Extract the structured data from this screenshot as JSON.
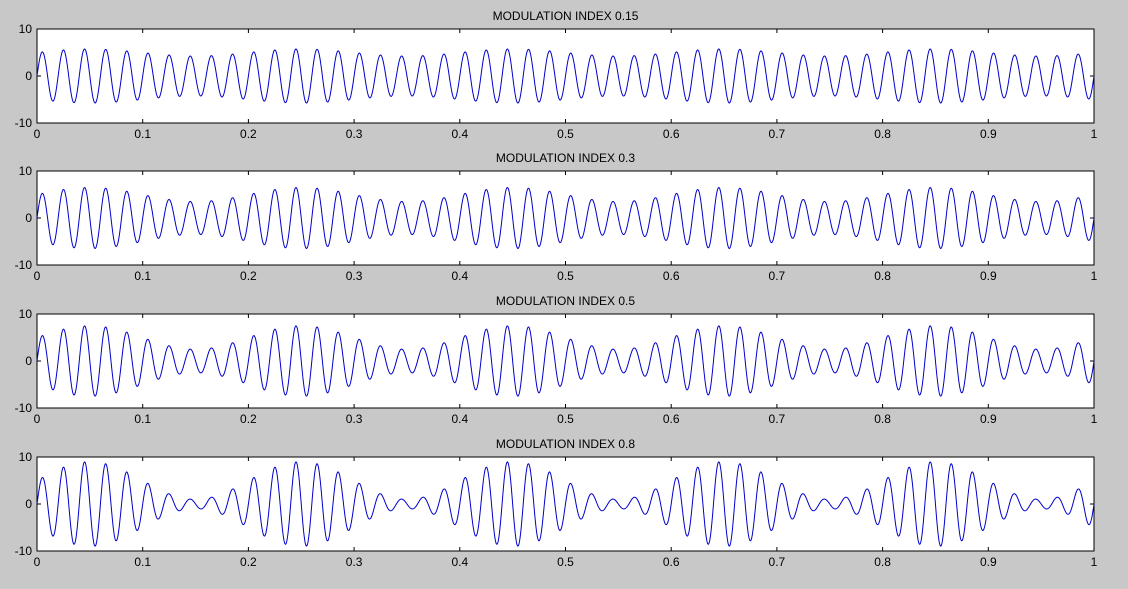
{
  "figure": {
    "background": "#c8c8c8",
    "axes_background": "#ffffff",
    "line_color": "#0000cc"
  },
  "chart_data": [
    {
      "type": "line",
      "title": "MODULATION INDEX 0.15",
      "xlabel": "",
      "ylabel": "",
      "xlim": [
        0,
        1
      ],
      "ylim": [
        -10,
        10
      ],
      "xticks": [
        0,
        0.1,
        0.2,
        0.3,
        0.4,
        0.5,
        0.6,
        0.7,
        0.8,
        0.9,
        1
      ],
      "xtick_labels": [
        "0",
        "0.1",
        "0.2",
        "0.3",
        "0.4",
        "0.5",
        "0.6",
        "0.7",
        "0.8",
        "0.9",
        "1"
      ],
      "yticks": [
        -10,
        0,
        10
      ],
      "ytick_labels": [
        "-10",
        "0",
        "10"
      ],
      "grid": false,
      "series": [
        {
          "function": "A*(1 + m*sin(2*pi*fm*t))*sin(2*pi*fc*t)",
          "A": 5,
          "m": 0.15,
          "fc": 50,
          "fm": 5,
          "t_range": [
            0,
            1
          ]
        }
      ]
    },
    {
      "type": "line",
      "title": "MODULATION INDEX 0.3",
      "xlabel": "",
      "ylabel": "",
      "xlim": [
        0,
        1
      ],
      "ylim": [
        -10,
        10
      ],
      "xticks": [
        0,
        0.1,
        0.2,
        0.3,
        0.4,
        0.5,
        0.6,
        0.7,
        0.8,
        0.9,
        1
      ],
      "xtick_labels": [
        "0",
        "0.1",
        "0.2",
        "0.3",
        "0.4",
        "0.5",
        "0.6",
        "0.7",
        "0.8",
        "0.9",
        "1"
      ],
      "yticks": [
        -10,
        0,
        10
      ],
      "ytick_labels": [
        "-10",
        "0",
        "10"
      ],
      "grid": false,
      "series": [
        {
          "function": "A*(1 + m*sin(2*pi*fm*t))*sin(2*pi*fc*t)",
          "A": 5,
          "m": 0.3,
          "fc": 50,
          "fm": 5,
          "t_range": [
            0,
            1
          ]
        }
      ]
    },
    {
      "type": "line",
      "title": "MODULATION INDEX 0.5",
      "xlabel": "",
      "ylabel": "",
      "xlim": [
        0,
        1
      ],
      "ylim": [
        -10,
        10
      ],
      "xticks": [
        0,
        0.1,
        0.2,
        0.3,
        0.4,
        0.5,
        0.6,
        0.7,
        0.8,
        0.9,
        1
      ],
      "xtick_labels": [
        "0",
        "0.1",
        "0.2",
        "0.3",
        "0.4",
        "0.5",
        "0.6",
        "0.7",
        "0.8",
        "0.9",
        "1"
      ],
      "yticks": [
        -10,
        0,
        10
      ],
      "ytick_labels": [
        "-10",
        "0",
        "10"
      ],
      "grid": false,
      "series": [
        {
          "function": "A*(1 + m*sin(2*pi*fm*t))*sin(2*pi*fc*t)",
          "A": 5,
          "m": 0.5,
          "fc": 50,
          "fm": 5,
          "t_range": [
            0,
            1
          ]
        }
      ]
    },
    {
      "type": "line",
      "title": "MODULATION INDEX 0.8",
      "xlabel": "",
      "ylabel": "",
      "xlim": [
        0,
        1
      ],
      "ylim": [
        -10,
        10
      ],
      "xticks": [
        0,
        0.1,
        0.2,
        0.3,
        0.4,
        0.5,
        0.6,
        0.7,
        0.8,
        0.9,
        1
      ],
      "xtick_labels": [
        "0",
        "0.1",
        "0.2",
        "0.3",
        "0.4",
        "0.5",
        "0.6",
        "0.7",
        "0.8",
        "0.9",
        "1"
      ],
      "yticks": [
        -10,
        0,
        10
      ],
      "ytick_labels": [
        "-10",
        "0",
        "10"
      ],
      "grid": false,
      "series": [
        {
          "function": "A*(1 + m*sin(2*pi*fm*t))*sin(2*pi*fc*t)",
          "A": 5,
          "m": 0.8,
          "fc": 50,
          "fm": 5,
          "t_range": [
            0,
            1
          ]
        }
      ]
    }
  ]
}
